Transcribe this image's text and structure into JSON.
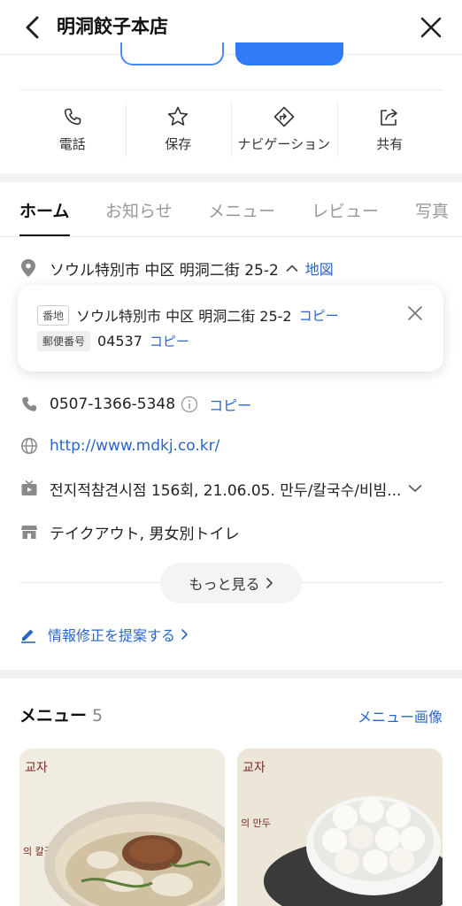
{
  "header": {
    "title": "明洞餃子本店"
  },
  "actions": [
    {
      "icon": "phone-icon",
      "label": "電話"
    },
    {
      "icon": "star-icon",
      "label": "保存"
    },
    {
      "icon": "navigation-icon",
      "label": "ナビゲーション"
    },
    {
      "icon": "share-icon",
      "label": "共有"
    }
  ],
  "tabs": [
    "ホーム",
    "お知らせ",
    "メニュー",
    "レビュー",
    "写真"
  ],
  "address": {
    "text": "ソウル特別市 中区 明洞二街 25-2",
    "map_link": "地図",
    "popup": {
      "lot_chip": "番地",
      "lot_text": "ソウル特別市 中区 明洞二街 25-2",
      "postal_chip": "郵便番号",
      "postal_text": "04537",
      "copy": "コピー"
    }
  },
  "phone": {
    "number": "0507-1366-5348",
    "copy": "コピー"
  },
  "website": {
    "url": "http://www.mdkj.co.kr/"
  },
  "tv": {
    "text": "전지적참견시점 156회, 21.06.05. 만두/칼국수/비빔..."
  },
  "facilities": {
    "text": "テイクアウト, 男女別トイレ"
  },
  "more_button": "もっと見る",
  "suggest": "情報修正を提案する",
  "menu": {
    "title": "メニュー",
    "count": "5",
    "image_link": "メニュー画像"
  },
  "colors": {
    "link": "#2866c9",
    "primary": "#2f7cf6"
  }
}
